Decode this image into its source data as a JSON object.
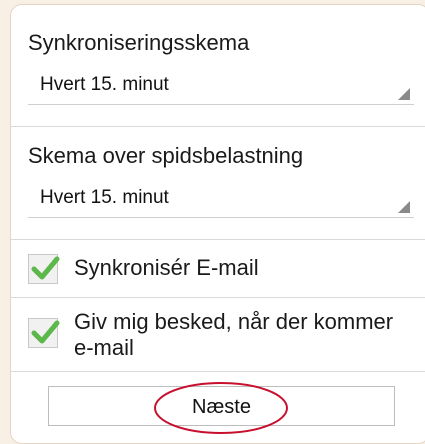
{
  "sync": {
    "label": "Synkroniseringsskema",
    "selected": "Hvert 15. minut"
  },
  "peak": {
    "label": "Skema over spidsbelastning",
    "selected": "Hvert 15. minut"
  },
  "options": {
    "sync_email": {
      "label": "Synkronisér E-mail",
      "checked": true
    },
    "notify_email": {
      "label_line1": "Giv mig besked, når der kommer",
      "label_line2": "e-mail",
      "checked": true
    }
  },
  "next_button": {
    "label": "Næste"
  },
  "colors": {
    "check_green": "#5cb84a",
    "annotation_red": "#c8102e"
  }
}
